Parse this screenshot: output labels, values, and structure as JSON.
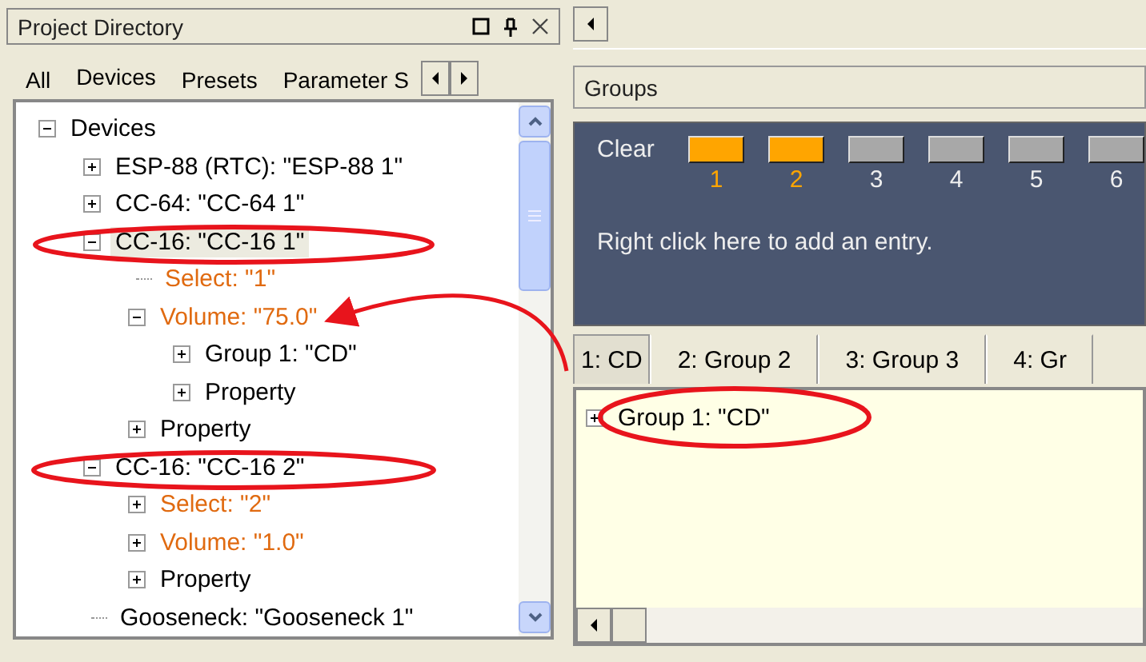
{
  "panel": {
    "title": "Project Directory"
  },
  "tabs": [
    {
      "label": "All",
      "selected": false
    },
    {
      "label": "Devices",
      "selected": true
    },
    {
      "label": "Presets",
      "selected": false
    },
    {
      "label": "Parameter S",
      "selected": false
    }
  ],
  "tree": [
    {
      "label": "Devices",
      "kind": "folder",
      "expanded": true,
      "selected": false,
      "color": "#000000",
      "children": [
        {
          "label": "ESP-88 (RTC): \"ESP-88 1\"",
          "kind": "folder",
          "expanded": false,
          "selected": false,
          "color": "#000000"
        },
        {
          "label": "CC-64: \"CC-64 1\"",
          "kind": "folder",
          "expanded": false,
          "selected": false,
          "color": "#000000"
        },
        {
          "label": "CC-16: \"CC-16 1\"",
          "kind": "folder",
          "expanded": true,
          "selected": true,
          "color": "#000000",
          "children": [
            {
              "label": "Select: \"1\"",
              "kind": "leaf",
              "selected": false,
              "color": "#e06a10"
            },
            {
              "label": "Volume: \"75.0\"",
              "kind": "folder",
              "expanded": true,
              "selected": false,
              "color": "#e06a10",
              "children": [
                {
                  "label": "Group 1: \"CD\"",
                  "kind": "folder",
                  "expanded": false,
                  "selected": false,
                  "color": "#000000"
                },
                {
                  "label": "Property",
                  "kind": "folder",
                  "expanded": false,
                  "selected": false,
                  "color": "#000000"
                }
              ]
            },
            {
              "label": "Property",
              "kind": "folder",
              "expanded": false,
              "selected": false,
              "color": "#000000"
            }
          ]
        },
        {
          "label": "CC-16: \"CC-16 2\"",
          "kind": "folder",
          "expanded": true,
          "selected": false,
          "color": "#000000",
          "children": [
            {
              "label": "Select: \"2\"",
              "kind": "folder",
              "expanded": false,
              "selected": false,
              "color": "#e06a10"
            },
            {
              "label": "Volume: \"1.0\"",
              "kind": "folder",
              "expanded": false,
              "selected": false,
              "color": "#e06a10"
            },
            {
              "label": "Property",
              "kind": "folder",
              "expanded": false,
              "selected": false,
              "color": "#000000"
            }
          ]
        },
        {
          "label": "Gooseneck: \"Gooseneck 1\"",
          "kind": "leaf",
          "selected": false,
          "color": "#000000"
        }
      ]
    }
  ],
  "groups": {
    "header": "Groups",
    "clear": "Clear",
    "buttons": [
      {
        "label": "1",
        "on": true
      },
      {
        "label": "2",
        "on": true
      },
      {
        "label": "3",
        "on": false
      },
      {
        "label": "4",
        "on": false
      },
      {
        "label": "5",
        "on": false
      },
      {
        "label": "6",
        "on": false
      }
    ],
    "hint": "Right click here to add an entry.",
    "tabs": [
      {
        "label": "1: CD",
        "selected": true
      },
      {
        "label": "2: Group 2",
        "selected": false
      },
      {
        "label": "3: Group 3",
        "selected": false
      },
      {
        "label": "4: Gr",
        "selected": false
      }
    ],
    "entries": [
      {
        "label": "Group 1: \"CD\"",
        "expanded": false
      }
    ]
  }
}
